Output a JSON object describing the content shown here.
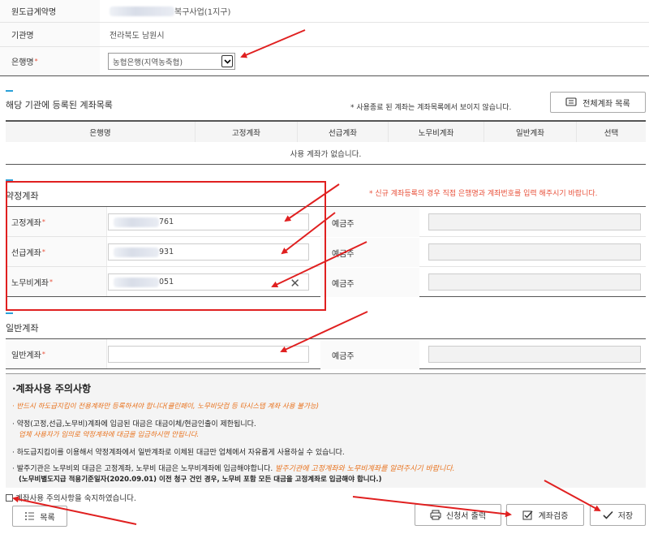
{
  "info": {
    "contract_name_label": "원도급계약명",
    "contract_name_suffix": "복구사업(1지구)",
    "agency_label": "기관명",
    "agency_value": "전라북도 남원시",
    "bank_label": "은행명",
    "bank_selected": "농협은행(지역농축협)",
    "required_mark": "*"
  },
  "registered": {
    "title": "해당 기관에 등록된 계좌목록",
    "note": "* 사용종료 된 계좌는 계좌목록에서 보이지 않습니다.",
    "all_accounts_button": "전체계좌 목록",
    "columns": [
      "은행명",
      "고정계좌",
      "선급계좌",
      "노무비계좌",
      "일반계좌",
      "선택"
    ],
    "empty_message": "사용 계좌가 없습니다."
  },
  "contract_accounts": {
    "title": "약정계좌",
    "notice": "* 신규 계좌등록의 경우 직접 은행명과 계좌번호를 입력 해주시기 바랍니다.",
    "rows": [
      {
        "label": "고정계좌",
        "value_suffix": "761",
        "depositor_label": "예금주"
      },
      {
        "label": "선급계좌",
        "value_suffix": "931",
        "depositor_label": "예금주"
      },
      {
        "label": "노무비계좌",
        "value_suffix": "051",
        "depositor_label": "예금주"
      }
    ]
  },
  "general_accounts": {
    "title": "일반계좌",
    "label": "일반계좌",
    "value": "",
    "depositor_label": "예금주"
  },
  "notice": {
    "title": "·계좌사용 주의사항",
    "line1": "· 반드시 하도급지킴이 전용계좌만 등록하셔야 합니다(클린페이, 노무비닷컴 등 타시스템 계좌 사용 불가능)",
    "line2": "· 약정(고정,선급,노무비)계좌에 입금된 대금은 대금이체/현금인출이 제한됩니다.",
    "line2b": "업체 사용자가 임의로 약정계좌에 대금을 입금하시면 안됩니다.",
    "line3": "· 하도급지킴이를 이용해서 약정계좌에서 일반계좌로 이체된 대금만 업체에서 자유롭게 사용하실 수 있습니다.",
    "line4a": "· 발주기관은 노무비외 대금은 고정계좌, 노무비 대금은 노무비계좌에 입금해야합니다.",
    "line4b": "발주기관에 고정계좌와 노무비계좌를 알려주시기 바랍니다.",
    "line5": "(노무비별도지급 적용기준일자(2020.09.01) 이전 청구 건인 경우, 노무비 포함 모든 대금을 고정계좌로 입금해야 합니다.)"
  },
  "agree_label": "계좌사용 주의사항을 숙지하였습니다.",
  "buttons": {
    "list": "목록",
    "print": "신청서 출력",
    "verify": "계좌검증",
    "save": "저장"
  },
  "colors": {
    "annotation": "#e02020",
    "accent": "#2aa0d8",
    "required": "#e8503a",
    "warning": "#e8731f"
  }
}
